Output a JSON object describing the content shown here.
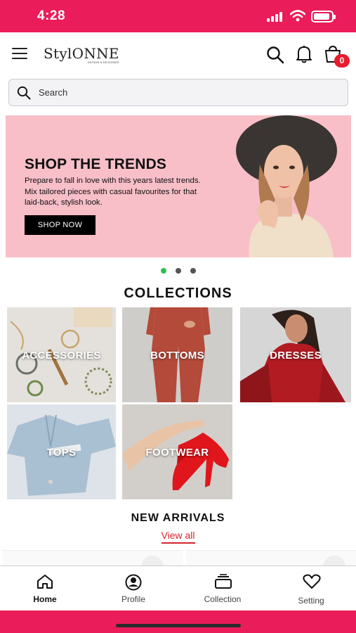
{
  "status_bar": {
    "time": "4:28"
  },
  "header": {
    "logo": "StylONNE",
    "logo_tagline": "DESIGN & DESIGNER",
    "cart_count": "0"
  },
  "search": {
    "placeholder": "Search"
  },
  "banner": {
    "title": "SHOP THE TRENDS",
    "text": "Prepare to fall in love with this years latest trends. Mix tailored pieces with casual favourites for that laid-back, stylish look.",
    "button": "SHOP NOW",
    "dots": 3,
    "active_dot": 0
  },
  "collections": {
    "title": "COLLECTIONS",
    "items": [
      {
        "label": "ACCESSORIES"
      },
      {
        "label": "BOTTOMS"
      },
      {
        "label": "DRESSES"
      },
      {
        "label": "TOPS"
      },
      {
        "label": "FOOTWEAR"
      }
    ]
  },
  "new_arrivals": {
    "title": "NEW ARRIVALS",
    "view_all": "View all"
  },
  "tab_bar": {
    "items": [
      {
        "label": "Home",
        "icon": "home-icon"
      },
      {
        "label": "Profile",
        "icon": "profile-icon"
      },
      {
        "label": "Collection",
        "icon": "collection-icon"
      },
      {
        "label": "Setting",
        "icon": "heart-icon"
      }
    ]
  },
  "colors": {
    "brand": "#ea1c5a",
    "banner_bg": "#f8bfc8",
    "accent_red": "#d4262e",
    "dot_active": "#2dbf4e"
  }
}
